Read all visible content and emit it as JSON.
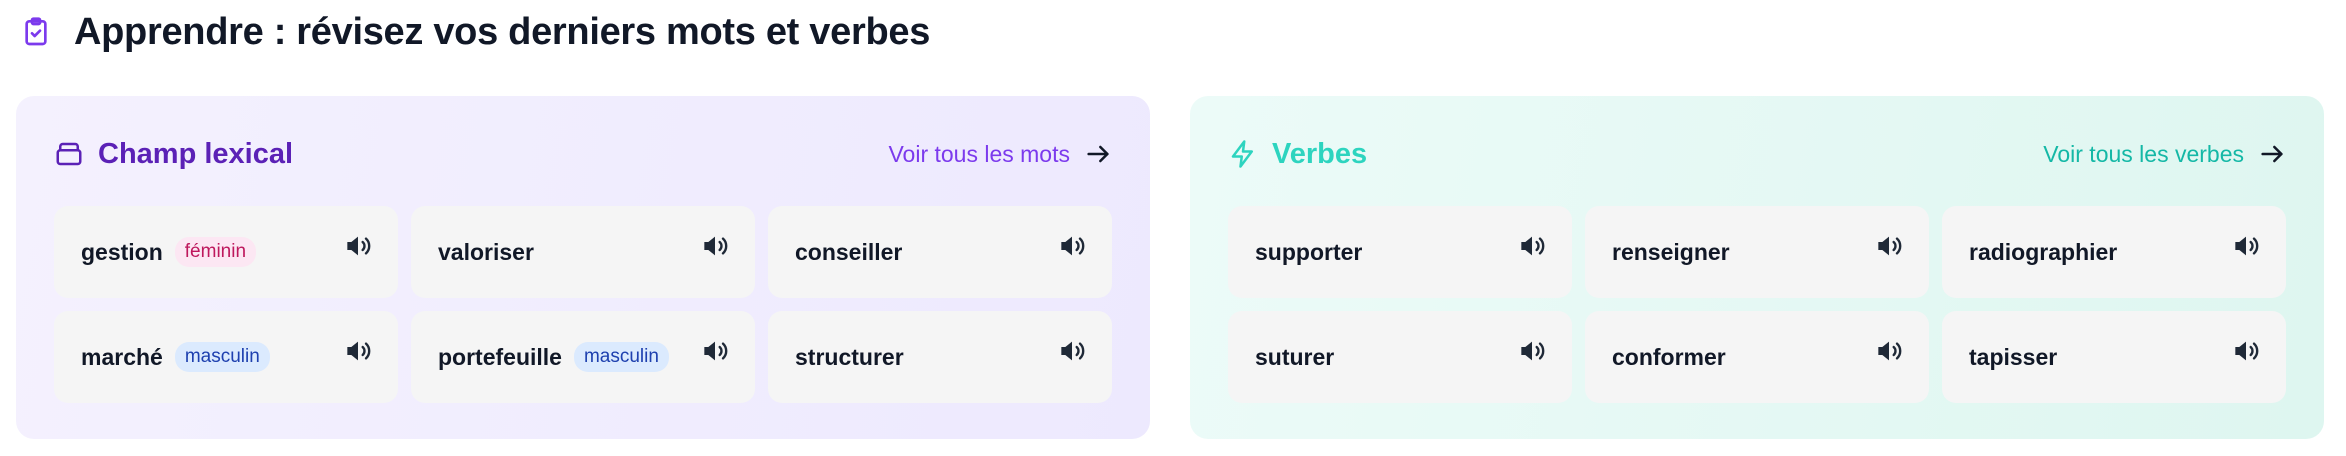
{
  "page": {
    "title": "Apprendre : révisez vos derniers mots et verbes",
    "title_icon": "clipboard-check-icon"
  },
  "colors": {
    "lexical_accent": "#5b21b6",
    "lexical_link": "#7c3aed",
    "verbs_accent": "#2dd4bf",
    "verbs_link": "#14b8a6",
    "feminine_badge_bg": "#fce7f3",
    "feminine_badge_text": "#be185d",
    "masculine_badge_bg": "#dbeafe",
    "masculine_badge_text": "#1e40af"
  },
  "lexical": {
    "title": "Champ lexical",
    "icon": "stack-icon",
    "see_all": "Voir tous les mots",
    "words": [
      {
        "word": "gestion",
        "gender": "féminin"
      },
      {
        "word": "valoriser"
      },
      {
        "word": "conseiller"
      },
      {
        "word": "marché",
        "gender": "masculin"
      },
      {
        "word": "portefeuille",
        "gender": "masculin"
      },
      {
        "word": "structurer"
      }
    ]
  },
  "verbs": {
    "title": "Verbes",
    "icon": "lightning-icon",
    "see_all": "Voir tous les verbes",
    "words": [
      {
        "word": "supporter"
      },
      {
        "word": "renseigner"
      },
      {
        "word": "radiographier"
      },
      {
        "word": "suturer"
      },
      {
        "word": "conformer"
      },
      {
        "word": "tapisser"
      }
    ]
  }
}
